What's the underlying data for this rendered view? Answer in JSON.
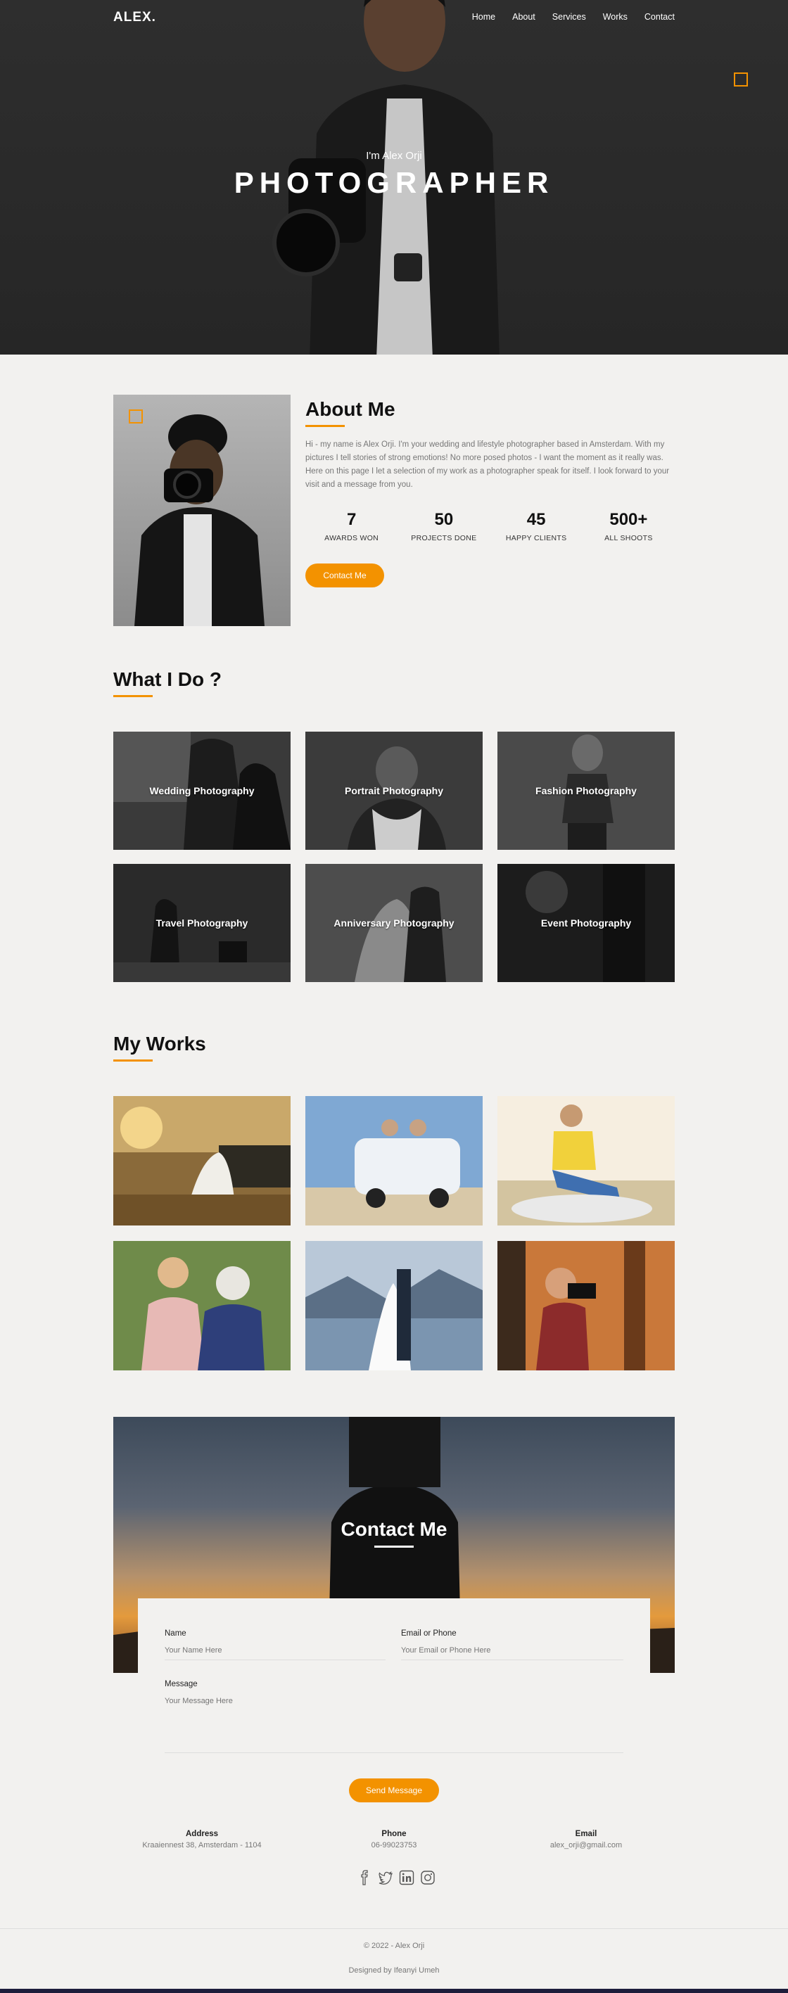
{
  "brand": {
    "logo": "ALEX.",
    "accent": "#f39200"
  },
  "nav": {
    "items": [
      "Home",
      "About",
      "Services",
      "Works",
      "Contact"
    ]
  },
  "hero": {
    "subtitle": "I'm Alex Orji",
    "title": "PHOTOGRAPHER"
  },
  "about": {
    "title": "About Me",
    "text": "Hi - my name is Alex Orji. I'm your wedding and lifestyle photographer based in Amsterdam. With my pictures I tell stories of strong emotions! No more posed photos - I want the moment as it really was. Here on this page I let a selection of my work as a photographer speak for itself. I look forward to your visit and a message from you.",
    "stats": [
      {
        "value": "7",
        "label": "AWARDS WON"
      },
      {
        "value": "50",
        "label": "PROJECTS DONE"
      },
      {
        "value": "45",
        "label": "HAPPY CLIENTS"
      },
      {
        "value": "500+",
        "label": "ALL SHOOTS"
      }
    ],
    "button": "Contact Me"
  },
  "services": {
    "title": "What I Do ?",
    "items": [
      "Wedding Photography",
      "Portrait Photography",
      "Fashion Photography",
      "Travel Photography",
      "Anniversary Photography",
      "Event Photography"
    ]
  },
  "works": {
    "title": "My Works"
  },
  "contact": {
    "title": "Contact Me",
    "name_label": "Name",
    "name_placeholder": "Your Name Here",
    "email_label": "Email or Phone",
    "email_placeholder": "Your Email or Phone Here",
    "message_label": "Message",
    "message_placeholder": "Your Message Here",
    "button": "Send Message"
  },
  "info": {
    "address_title": "Address",
    "address": "Kraaiennest 38, Amsterdam - 1104",
    "phone_title": "Phone",
    "phone": "06-99023753",
    "email_title": "Email",
    "email": "alex_orji@gmail.com"
  },
  "footer": {
    "copyright": "© 2022 - Alex Orji",
    "credit": "Designed by Ifeanyi Umeh"
  }
}
